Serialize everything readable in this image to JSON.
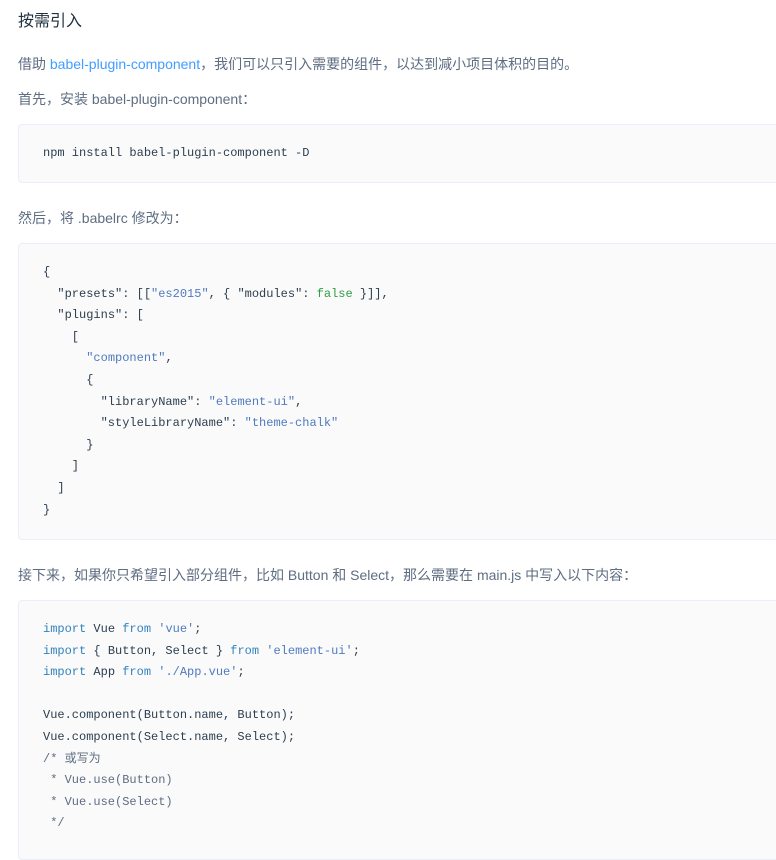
{
  "section": {
    "heading": "按需引入",
    "intro": {
      "before": "借助 ",
      "link": "babel-plugin-component",
      "after": "，我们可以只引入需要的组件，以达到减小项目体积的目的。"
    },
    "step1": "首先，安装 babel-plugin-component：",
    "install_cmd": "npm install babel-plugin-component -D",
    "step2": "然后，将 .babelrc 修改为：",
    "babelrc_lines": [
      [
        [
          "p",
          "{"
        ]
      ],
      [
        [
          "p",
          "  "
        ],
        [
          "key",
          "\"presets\""
        ],
        [
          "p",
          ": [["
        ],
        [
          "str",
          "\"es2015\""
        ],
        [
          "p",
          ", { "
        ],
        [
          "key",
          "\"modules\""
        ],
        [
          "p",
          ": "
        ],
        [
          "bool",
          "false"
        ],
        [
          "p",
          " }]],"
        ]
      ],
      [
        [
          "p",
          "  "
        ],
        [
          "key",
          "\"plugins\""
        ],
        [
          "p",
          ": ["
        ]
      ],
      [
        [
          "p",
          "    ["
        ]
      ],
      [
        [
          "p",
          "      "
        ],
        [
          "str",
          "\"component\""
        ],
        [
          "p",
          ","
        ]
      ],
      [
        [
          "p",
          "      {"
        ]
      ],
      [
        [
          "p",
          "        "
        ],
        [
          "key",
          "\"libraryName\""
        ],
        [
          "p",
          ": "
        ],
        [
          "str",
          "\"element-ui\""
        ],
        [
          "p",
          ","
        ]
      ],
      [
        [
          "p",
          "        "
        ],
        [
          "key",
          "\"styleLibraryName\""
        ],
        [
          "p",
          ": "
        ],
        [
          "str",
          "\"theme-chalk\""
        ]
      ],
      [
        [
          "p",
          "      }"
        ]
      ],
      [
        [
          "p",
          "    ]"
        ]
      ],
      [
        [
          "p",
          "  ]"
        ]
      ],
      [
        [
          "p",
          "}"
        ]
      ]
    ],
    "step3": "接下来，如果你只希望引入部分组件，比如 Button 和 Select，那么需要在 main.js 中写入以下内容：",
    "mainjs_lines": [
      [
        [
          "kw",
          "import"
        ],
        [
          "p",
          " Vue "
        ],
        [
          "kw",
          "from"
        ],
        [
          "p",
          " "
        ],
        [
          "str",
          "'vue'"
        ],
        [
          "p",
          ";"
        ]
      ],
      [
        [
          "kw",
          "import"
        ],
        [
          "p",
          " { Button, Select } "
        ],
        [
          "kw",
          "from"
        ],
        [
          "p",
          " "
        ],
        [
          "str",
          "'element-ui'"
        ],
        [
          "p",
          ";"
        ]
      ],
      [
        [
          "kw",
          "import"
        ],
        [
          "p",
          " App "
        ],
        [
          "kw",
          "from"
        ],
        [
          "p",
          " "
        ],
        [
          "str",
          "'./App.vue'"
        ],
        [
          "p",
          ";"
        ]
      ],
      [
        [
          "p",
          ""
        ]
      ],
      [
        [
          "p",
          "Vue.component(Button.name, Button);"
        ]
      ],
      [
        [
          "p",
          "Vue.component(Select.name, Select);"
        ]
      ],
      [
        [
          "cm",
          "/* 或写为"
        ]
      ],
      [
        [
          "cm",
          " * Vue.use(Button)"
        ]
      ],
      [
        [
          "cm",
          " * Vue.use(Select)"
        ]
      ],
      [
        [
          "cm",
          " */"
        ]
      ]
    ]
  }
}
